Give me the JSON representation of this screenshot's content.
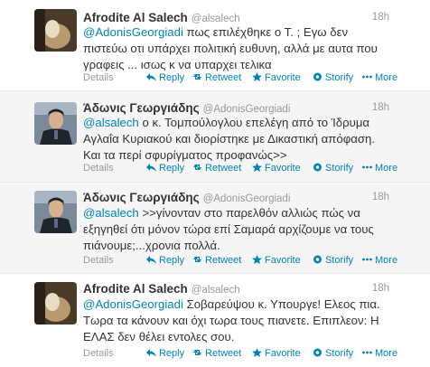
{
  "actions": {
    "details": "Details",
    "reply": "Reply",
    "retweet": "Retweet",
    "favorite": "Favorite",
    "storify": "Storify",
    "more": "More"
  },
  "tweets": [
    {
      "name": "Afrodite Al Salech",
      "handle": "@alsalech",
      "time": "18h",
      "mention": "@AdonisGeorgiadi",
      "text": " πως επιλέχθηκε ο Τ. ; Εγω δεν πιστεύω οτι υπάρχει πολιτική ευθυνη, αλλά με αυτα που γραφεις ... ισως κ να υπαρχει τελικα"
    },
    {
      "name": "Άδωνις Γεωργιάδης",
      "handle": "@AdonisGeorgiadi",
      "time": "18h",
      "mention": "@alsalech",
      "text": " ο κ. Τομπούλογλου επελέγη από το Ίδρυμα Αγλαΐα Κυριακού και διορίστηκε με Δικαστική απόφαση. Και τα περί σφυρίγματος προφανώς>>"
    },
    {
      "name": "Άδωνις Γεωργιάδης",
      "handle": "@AdonisGeorgiadi",
      "time": "18h",
      "mention": "@alsalech",
      "text": " >>γίνονταν στο παρελθόν αλλιώς πώς να εξηγηθεί ότι μόνον τώρα επί Σαμαρά αρχίζουμε να τους πιάνουμε;...χρονια πολλά."
    },
    {
      "name": "Afrodite Al Salech",
      "handle": "@alsalech",
      "time": "18h",
      "mention": "@AdonisGeorgiadi",
      "text": " Σοβαρεύψου κ. Υπουργε! Ελεος πια. Τωρα τα κάνουν και όχι τωρα τους πιανετε. Επιπλεον: Η ΕΛΑΣ δεν θέλει εντολες σου."
    }
  ]
}
